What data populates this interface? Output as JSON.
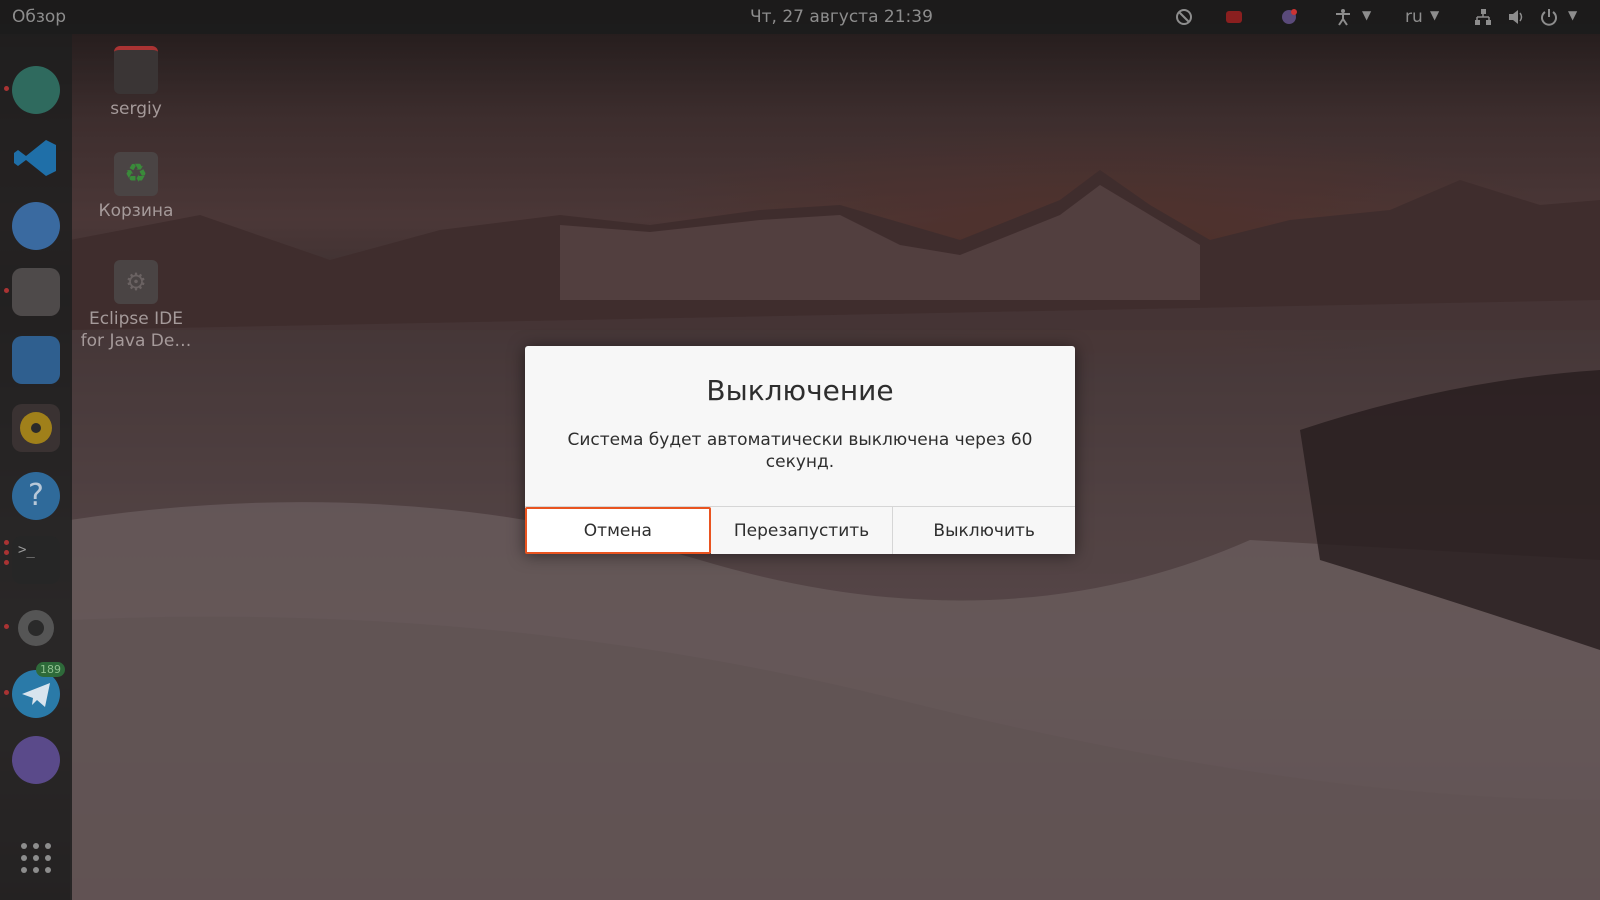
{
  "topbar": {
    "activities": "Обзор",
    "clock": "Чт, 27 августа  21:39",
    "language": "ru",
    "tray_icons": [
      "vpn-icon",
      "screen-record-icon",
      "network-globe-icon",
      "accessibility-icon",
      "network-icon",
      "volume-icon",
      "power-icon"
    ]
  },
  "dock": {
    "items": [
      "clock-app-icon",
      "vscode-icon",
      "thunderbird-icon",
      "files-icon",
      "writer-icon",
      "rhythmbox-icon",
      "help-icon",
      "terminal-icon",
      "settings-icon",
      "telegram-icon",
      "viber-icon",
      "show-apps-icon"
    ],
    "telegram_badge": "189"
  },
  "desktop": {
    "icons": [
      {
        "label": "sergiy",
        "icon": "home-folder-icon"
      },
      {
        "label": "Корзина",
        "icon": "trash-icon"
      },
      {
        "label": "Eclipse IDE for Java De…",
        "icon": "eclipse-icon"
      }
    ]
  },
  "dialog": {
    "title": "Выключение",
    "message": "Система будет автоматически выключена через 60 секунд.",
    "buttons": {
      "cancel": "Отмена",
      "restart": "Перезапустить",
      "shutdown": "Выключить"
    }
  },
  "colors": {
    "accent": "#e95420",
    "dialog_bg": "#f7f7f7",
    "topbar_bg": "#1c1c1c"
  }
}
